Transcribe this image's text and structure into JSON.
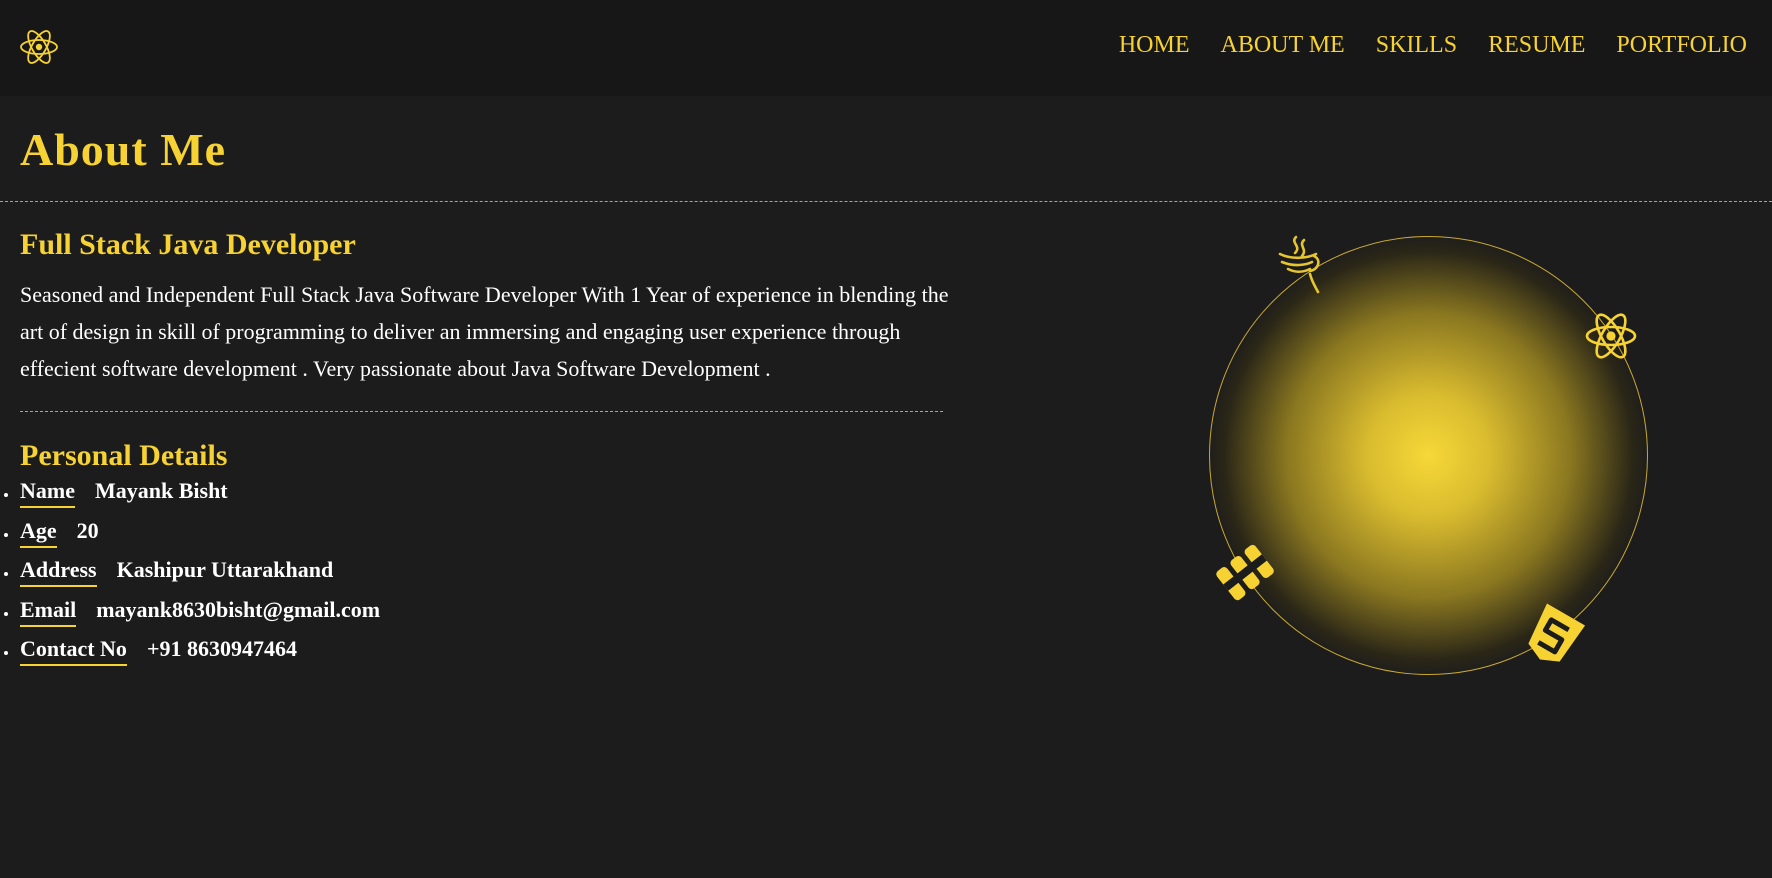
{
  "brand": {
    "logo_icon": "react-atom-icon"
  },
  "nav": {
    "items": [
      {
        "label": "HOME"
      },
      {
        "label": "ABOUT ME"
      },
      {
        "label": "SKILLS"
      },
      {
        "label": "RESUME"
      },
      {
        "label": "PORTFOLIO"
      }
    ]
  },
  "page": {
    "title": "About Me"
  },
  "about": {
    "headline": "Full Stack Java Developer",
    "summary": "Seasoned and Independent Full Stack Java Software Developer With 1 Year of experience in blending the art of design in skill of programming to deliver an immersing and engaging user experience through effecient software development . Very passionate about Java Software Development ."
  },
  "personal": {
    "title": "Personal Details",
    "items": [
      {
        "label": "Name",
        "value": "Mayank Bisht"
      },
      {
        "label": "Age",
        "value": "20"
      },
      {
        "label": "Address",
        "value": "Kashipur Uttarakhand"
      },
      {
        "label": "Email",
        "value": "mayank8630bisht@gmail.com"
      },
      {
        "label": "Contact No",
        "value": "+91 8630947464"
      }
    ]
  },
  "orbit_icons": [
    "java-icon",
    "react-atom-icon",
    "database-icon",
    "css-icon"
  ],
  "colors": {
    "accent": "#f6d232",
    "background": "#1c1c1c",
    "navbar": "#171717",
    "text": "#ffffff"
  }
}
